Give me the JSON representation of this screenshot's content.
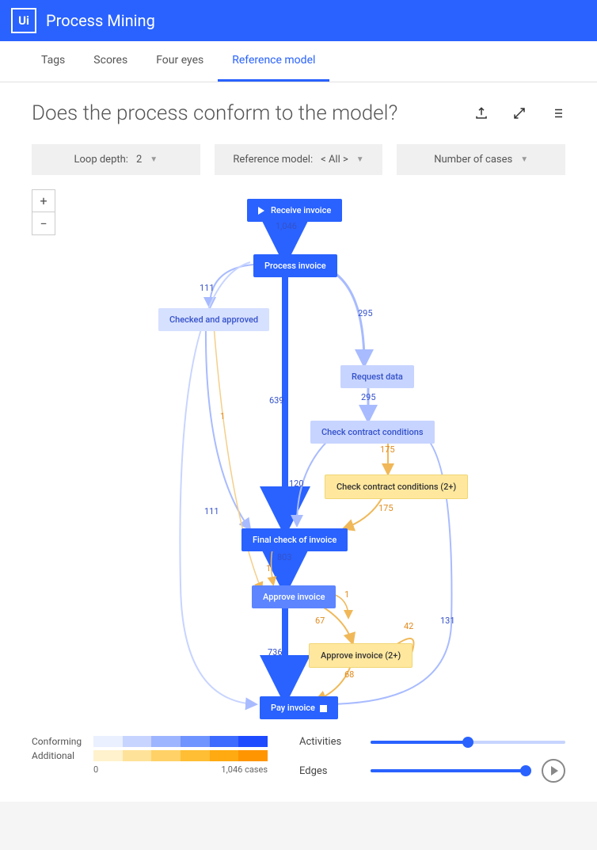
{
  "header": {
    "app_name": "Process Mining"
  },
  "tabs": [
    {
      "label": "Tags",
      "active": false
    },
    {
      "label": "Scores",
      "active": false
    },
    {
      "label": "Four eyes",
      "active": false
    },
    {
      "label": "Reference model",
      "active": true
    }
  ],
  "page": {
    "title": "Does the process conform to the model?"
  },
  "filters": {
    "loop_depth": {
      "label": "Loop depth:",
      "value": "2"
    },
    "reference_model": {
      "label": "Reference model:",
      "value": "< All >"
    },
    "number_of_cases": {
      "label": "Number of cases"
    }
  },
  "nodes": {
    "receive_invoice": "Receive invoice",
    "process_invoice": "Process invoice",
    "checked_approved": "Checked and approved",
    "request_data": "Request data",
    "check_contract": "Check contract conditions",
    "check_contract_2": "Check contract conditions (2+)",
    "final_check": "Final check of invoice",
    "approve_invoice": "Approve invoice",
    "approve_invoice_2": "Approve invoice (2+)",
    "pay_invoice": "Pay invoice"
  },
  "edges": {
    "e1046": "1,046",
    "e111": "111",
    "e295": "295",
    "e295b": "295",
    "e639": "639",
    "e175": "175",
    "e120": "120",
    "e175b": "175",
    "e111b": "111",
    "e803": "803",
    "e1": "1",
    "e1b": "1",
    "e1c": "1",
    "e67": "67",
    "e42": "42",
    "e131": "131",
    "e736": "736",
    "e68": "68"
  },
  "legend": {
    "conforming": "Conforming",
    "additional": "Additional",
    "scale_min": "0",
    "scale_max": "1,046",
    "scale_unit": "cases",
    "activities": "Activities",
    "edges_lbl": "Edges"
  }
}
